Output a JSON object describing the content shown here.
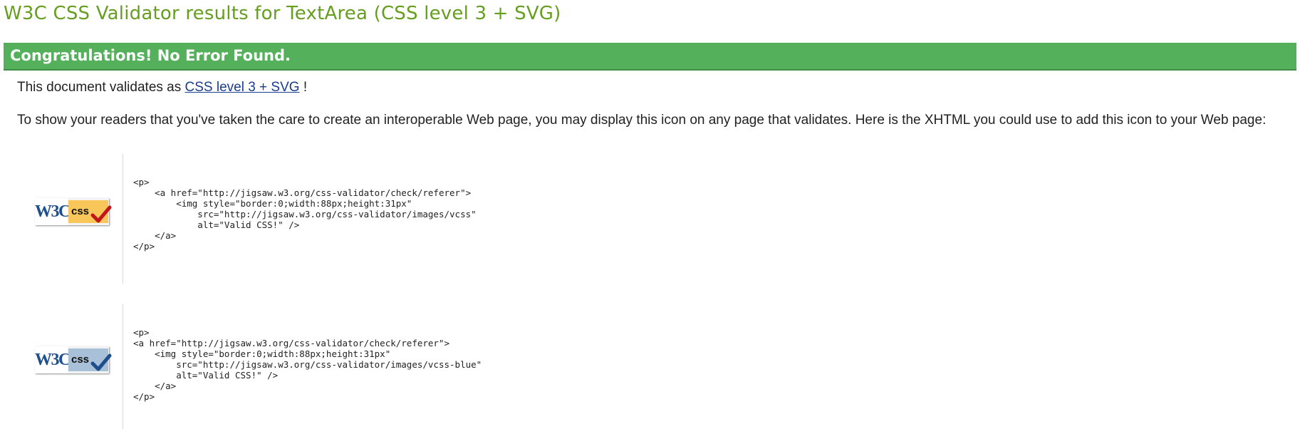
{
  "page": {
    "title": "W3C CSS Validator results for TextArea (CSS level 3 + SVG)"
  },
  "banner": {
    "text": "Congratulations! No Error Found.",
    "color": "#54b05a"
  },
  "validates": {
    "prefix": "This document validates as ",
    "link_text": "CSS level 3 + SVG",
    "suffix": " !"
  },
  "info": {
    "text": "To show your readers that you've taken the care to create an interoperable Web page, you may display this icon on any page that validates. Here is the XHTML you could use to add this icon to your Web page:"
  },
  "badges": [
    {
      "icon": "w3c-css-valid-gold-icon",
      "w3c_text": "W3C",
      "css_text": "css",
      "accent": "#f9c65a",
      "check_color": "#c01818",
      "code": "<p>\n    <a href=\"http://jigsaw.w3.org/css-validator/check/referer\">\n        <img style=\"border:0;width:88px;height:31px\"\n            src=\"http://jigsaw.w3.org/css-validator/images/vcss\"\n            alt=\"Valid CSS!\" />\n    </a>\n</p>"
    },
    {
      "icon": "w3c-css-valid-blue-icon",
      "w3c_text": "W3C",
      "css_text": "css",
      "accent": "#a8c0d8",
      "check_color": "#1c4f8c",
      "code": "<p>\n<a href=\"http://jigsaw.w3.org/css-validator/check/referer\">\n    <img style=\"border:0;width:88px;height:31px\"\n        src=\"http://jigsaw.w3.org/css-validator/images/vcss-blue\"\n        alt=\"Valid CSS!\" />\n    </a>\n</p>"
    }
  ]
}
